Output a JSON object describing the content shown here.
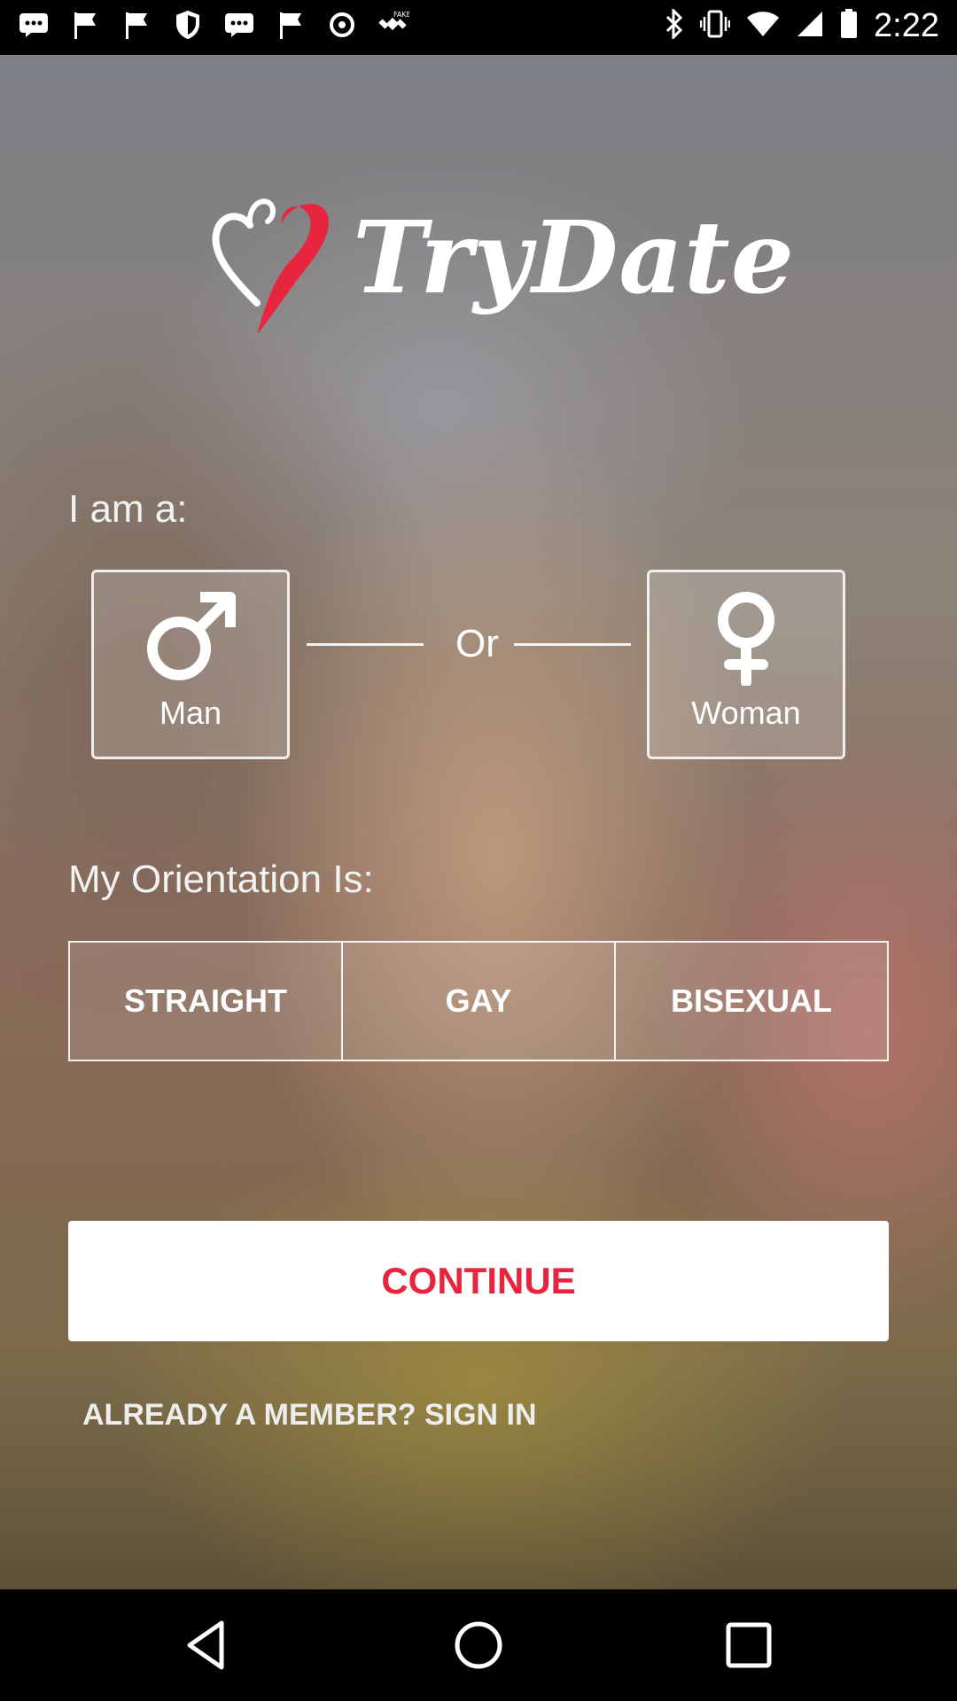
{
  "status_bar": {
    "time": "2:22",
    "icons": [
      "message-icon",
      "flag-icon",
      "flag-icon",
      "shield-icon",
      "message-icon",
      "flag-icon",
      "settings-icon",
      "satellite-icon",
      "bluetooth-icon",
      "vibrate-icon",
      "wifi-icon",
      "signal-icon",
      "battery-icon"
    ]
  },
  "app": {
    "logo_text": "TryDate",
    "brand_color": "#e8253e"
  },
  "gender": {
    "label": "I am a:",
    "man_label": "Man",
    "or_label": "Or",
    "woman_label": "Woman"
  },
  "orientation": {
    "label": "My Orientation Is:",
    "options": [
      "STRAIGHT",
      "GAY",
      "BISEXUAL"
    ]
  },
  "actions": {
    "continue_label": "CONTINUE",
    "signin_label": "ALREADY A MEMBER? SIGN IN"
  },
  "nav": {
    "buttons": [
      "back-icon",
      "home-icon",
      "recents-icon"
    ]
  }
}
